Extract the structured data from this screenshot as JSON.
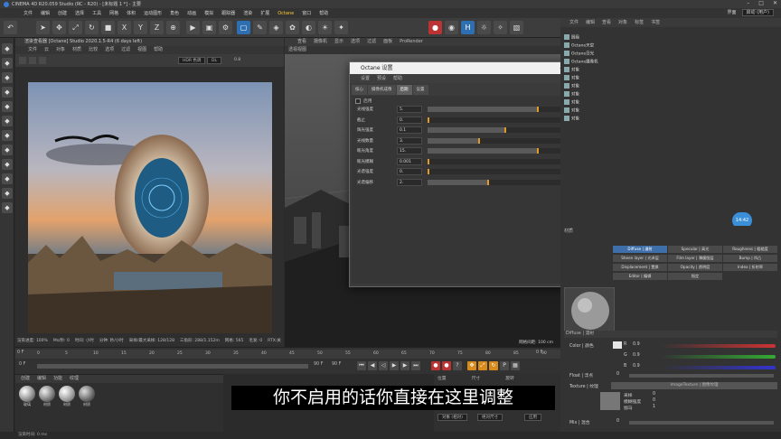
{
  "window": {
    "title": "CINEMA 4D R20.059 Studio (RC - R20) - [未标题 1 *] - 主要"
  },
  "menubar": {
    "items": [
      "文件",
      "编辑",
      "创建",
      "选择",
      "工具",
      "网格",
      "体积",
      "运动图形",
      "角色",
      "动画",
      "模拟",
      "跟踪器",
      "渲染",
      "扩展",
      "Octane",
      "窗口",
      "帮助"
    ],
    "highlight_index": 14,
    "right": {
      "label": "界面",
      "value": "启动 (用户)"
    }
  },
  "renderview": {
    "title": "渲染查看器 [Octane] Studio 2020.1.5-R4 (6 days left)",
    "menu": [
      "文件",
      "云",
      "对象",
      "材质",
      "比较",
      "选项",
      "过滤",
      "视图",
      "帮助"
    ],
    "hdr_mode": "HDR 色调",
    "dl_mode": "DL",
    "dl_value": "0.8",
    "status": [
      "渲染进度: 100%",
      "Ms/秒: 0",
      "时间: 小时",
      "分钟: 秒/小时",
      "采样/最大采样: 128/128",
      "三角形: 288/1.152m",
      "网格: 565",
      "毛发: 0",
      "RTX:关"
    ]
  },
  "viewport": {
    "tabs": [
      "查看",
      "摄像机",
      "显示",
      "选项",
      "过滤",
      "面板",
      "ProRender"
    ],
    "label": "透视视图",
    "scale": "网格间距: 100 cm"
  },
  "octane_dialog": {
    "title": "Octane 设置",
    "menu": [
      "设置",
      "预设",
      "帮助"
    ],
    "tabs": [
      "核心",
      "摄像机成像",
      "后期",
      "设置"
    ],
    "active_tab": 2,
    "enable_label": "启用",
    "params": [
      {
        "label": "光线强度",
        "value": "5.",
        "fill": 0.62
      },
      {
        "label": "截止",
        "value": "0.",
        "fill": 0.0
      },
      {
        "label": "辉光强度",
        "value": "0.1",
        "fill": 0.44
      },
      {
        "label": "光线数量",
        "value": "3.",
        "fill": 0.29
      },
      {
        "label": "眩光角度",
        "value": "15.",
        "fill": 0.62
      },
      {
        "label": "眩光模糊",
        "value": "0.001",
        "fill": 0.0
      },
      {
        "label": "光谱强度",
        "value": "0.",
        "fill": 0.0
      },
      {
        "label": "光谱偏移",
        "value": "2.",
        "fill": 0.34
      }
    ]
  },
  "objects": {
    "header": [
      "文件",
      "编辑",
      "查看",
      "对象",
      "标签",
      "书签"
    ],
    "items": [
      "圆盘",
      "Octane天空",
      "Octane日光",
      "Octane摄像机",
      "对象",
      "对象",
      "对象",
      "对象",
      "对象",
      "对象",
      "对象"
    ]
  },
  "time_badge": "14:42",
  "attributes": {
    "header": "材质",
    "channels": [
      [
        "Diffuse | 漫射",
        "Specular | 高光",
        "Roughness | 粗糙度"
      ],
      [
        "Sheen layer | 光泽层",
        "Film layer | 薄膜图层",
        "Bump | 凹凸"
      ],
      [
        "Displacement | 置换",
        "Opacity | 透明度",
        "Index | 折射率"
      ],
      [
        "Editor | 编辑",
        "指定",
        ""
      ]
    ],
    "section": "Diffuse | 漫射",
    "color_label": "Color | 颜色",
    "r": "0.9",
    "g": "0.9",
    "b": "0.9",
    "r_label": "R",
    "g_label": "G",
    "b_label": "B",
    "float_label": "Float | 浮点",
    "float_value": "0",
    "texture_label": "Texture | 纹理",
    "texture_value": "ImageTexture | 图像纹理",
    "sample_labels": [
      "采样",
      "模糊强度",
      "伽马"
    ],
    "sample_values": [
      "0",
      "0",
      "1"
    ],
    "mix_label": "Mix | 混合",
    "mix_value": "0"
  },
  "timeline": {
    "ticks": [
      "0",
      "5",
      "10",
      "15",
      "20",
      "25",
      "30",
      "35",
      "40",
      "45",
      "50",
      "55",
      "60",
      "65",
      "70",
      "75",
      "80",
      "85",
      "90"
    ],
    "frame_current": "0 F",
    "frame_start": "0 F",
    "frame_end": "90 F",
    "frame_end2": "90 F",
    "frame_right": "0 F"
  },
  "material_manager": {
    "menu": [
      "创建",
      "编辑",
      "功能",
      "纹理"
    ],
    "materials": [
      "玻璃",
      "材质",
      "材质",
      "材质"
    ]
  },
  "coord": {
    "labels": [
      "位置",
      "尺寸",
      "旋转"
    ],
    "mode": "对象 (相对)",
    "size_mode": "绝对尺寸",
    "apply": "应用"
  },
  "subtitle": "你不启用的话你直接在这里调整",
  "statusbar": "渲染时间: 0 ms"
}
